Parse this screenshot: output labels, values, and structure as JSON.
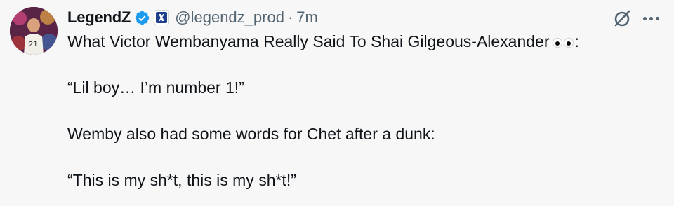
{
  "author": {
    "display_name": "LegendZ",
    "handle": "@legendz_prod",
    "separator": "·",
    "time": "7m",
    "verified": true,
    "affiliate_badge": "x-affiliate-icon",
    "avatar_jersey_number": "21"
  },
  "tweet": {
    "line1_before_emoji": "What Victor Wembanyama Really Said To Shai Gilgeous-Alexander",
    "line1_emoji": "eyes-emoji",
    "line1_after_emoji": ":",
    "paragraph2": "“Lil boy… I’m number 1!”",
    "paragraph3": "Wemby also had some words for Chet after a dunk:",
    "paragraph4": "“This is my sh*t, this is my sh*t!”"
  },
  "icons": {
    "grok": "grok-icon",
    "more": "more-options-icon"
  },
  "colors": {
    "verified_blue": "#1d9bf0",
    "secondary_text": "#536471",
    "background": "#f7f7f8",
    "primary_text": "#0f1419"
  }
}
